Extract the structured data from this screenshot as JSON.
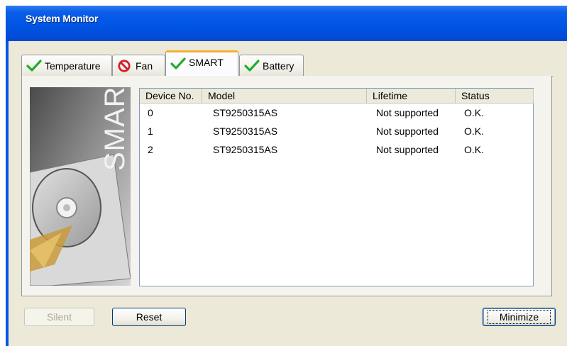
{
  "window": {
    "title": "System Monitor"
  },
  "tabs": [
    {
      "label": "Temperature",
      "icon": "check-icon"
    },
    {
      "label": "Fan",
      "icon": "prohibited-icon"
    },
    {
      "label": "SMART",
      "icon": "check-icon",
      "active": true
    },
    {
      "label": "Battery",
      "icon": "check-icon"
    }
  ],
  "smart_panel": {
    "image_caption": "SMART",
    "columns": [
      "Device No.",
      "Model",
      "Lifetime",
      "Status"
    ],
    "rows": [
      {
        "device": "0",
        "model": "ST9250315AS",
        "lifetime": "Not supported",
        "status": "O.K."
      },
      {
        "device": "1",
        "model": "ST9250315AS",
        "lifetime": "Not supported",
        "status": "O.K."
      },
      {
        "device": "2",
        "model": "ST9250315AS",
        "lifetime": "Not supported",
        "status": "O.K."
      }
    ]
  },
  "buttons": {
    "silent": "Silent",
    "reset": "Reset",
    "minimize": "Minimize"
  },
  "colors": {
    "titlebar": "#0055e5",
    "check": "#1fae2c",
    "prohibited": "#d6202b",
    "active_tab_accent": "#f3b232"
  }
}
